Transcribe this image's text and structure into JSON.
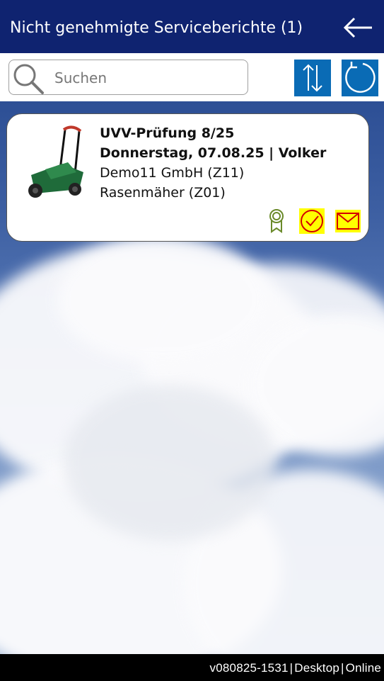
{
  "header": {
    "title": "Nicht genehmigte Serviceberichte (1)",
    "back_icon": "arrow-left-icon"
  },
  "search": {
    "placeholder": "Suchen",
    "value": ""
  },
  "toolbar": {
    "sort_icon": "sort-arrows-icon",
    "refresh_icon": "refresh-icon",
    "button_color": "#0a6bb5"
  },
  "reports": [
    {
      "title": "UVV-Prüfung 8/25",
      "date_line": "Donnerstag, 07.08.25 | Volker",
      "customer": "Demo11 GmbH (Z11)",
      "device": "Rasenmäher (Z01)",
      "image": "lawn-mower-image",
      "actions": [
        "certificate-icon",
        "approve-check-icon",
        "mail-icon"
      ]
    }
  ],
  "footer": {
    "version": "v080825-1531",
    "mode": "Desktop",
    "status": "Online"
  },
  "colors": {
    "header_bg": "#0f2370",
    "highlight": "#ffff00",
    "icon_red": "#d40000",
    "cert_green": "#6a8a2a"
  }
}
